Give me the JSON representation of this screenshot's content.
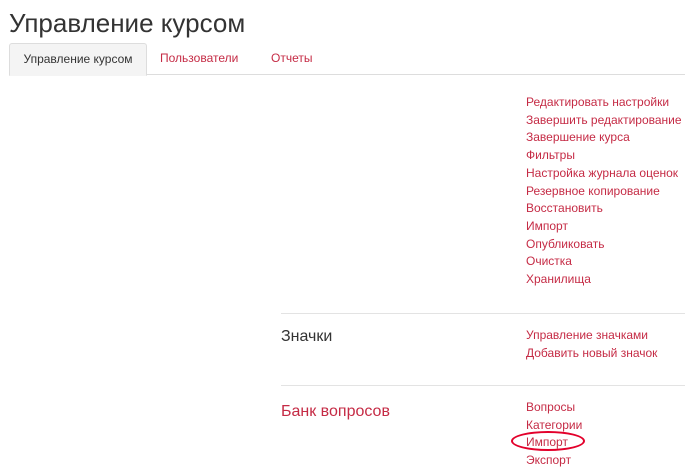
{
  "page": {
    "title": "Управление курсом"
  },
  "tabs": [
    {
      "label": "Управление курсом"
    },
    {
      "label": "Пользователи"
    },
    {
      "label": "Отчеты"
    }
  ],
  "sections": {
    "course": {
      "links": [
        "Редактировать настройки",
        "Завершить редактирование",
        "Завершение курса",
        "Фильтры",
        "Настройка журнала оценок",
        "Резервное копирование",
        "Восстановить",
        "Импорт",
        "Опубликовать",
        "Очистка",
        "Хранилища"
      ]
    },
    "badges": {
      "heading": "Значки",
      "links": [
        "Управление значками",
        "Добавить новый значок"
      ]
    },
    "question_bank": {
      "heading": "Банк вопросов",
      "links": [
        "Вопросы",
        "Категории",
        "Импорт",
        "Экспорт"
      ]
    }
  },
  "colors": {
    "link": "#c52b45",
    "text": "#333333",
    "highlight": "#e3002b"
  }
}
